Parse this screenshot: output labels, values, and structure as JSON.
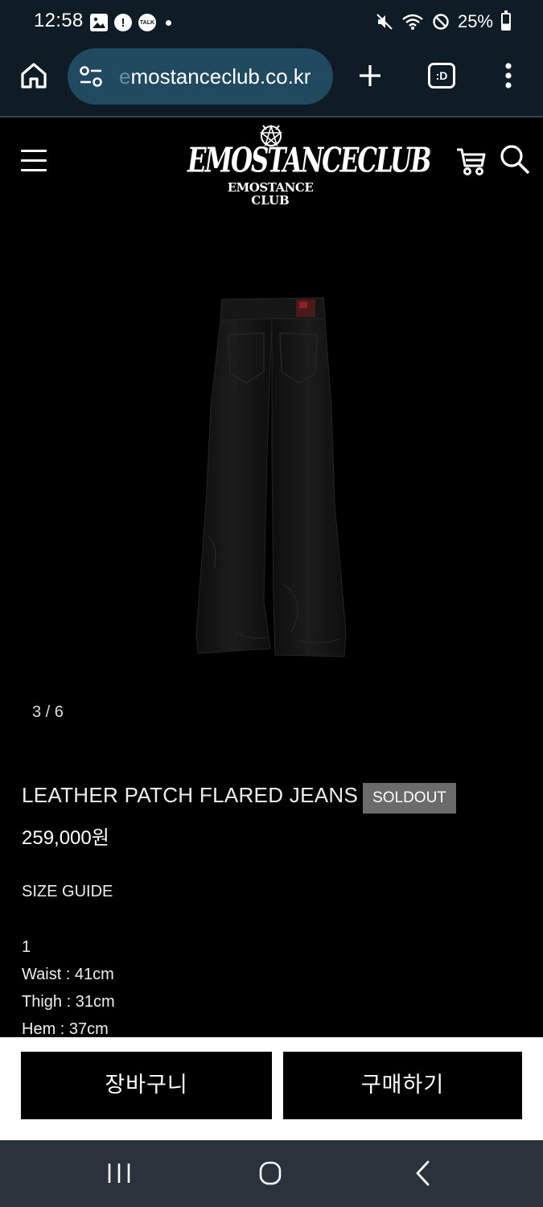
{
  "status_bar": {
    "time": "12:58",
    "battery": "25%",
    "left_icons": [
      "gallery-icon",
      "alert-icon",
      "kakaotalk-icon",
      "dot-icon"
    ],
    "talk_label": "TALK",
    "alert_label": "!",
    "right_icons": [
      "mute-icon",
      "wifi-icon",
      "do-not-disturb-icon",
      "battery-icon"
    ]
  },
  "browser": {
    "url_prefix": "e",
    "url": "mostanceclub.co.kr",
    "tabs_label": ":D",
    "icons": [
      "home-icon",
      "site-settings-icon",
      "plus-icon",
      "tabs-icon",
      "more-vert-icon"
    ]
  },
  "site_header": {
    "logo_main": "EMOSTANCECLUB",
    "logo_sub_1": "EMOSTANCE",
    "logo_sub_2": "CLUB",
    "icons": [
      "hamburger-menu-icon",
      "cart-icon",
      "search-icon"
    ]
  },
  "gallery": {
    "counter": "3 / 6"
  },
  "product": {
    "name": "LEATHER PATCH FLARED JEANS",
    "badge": "SOLDOUT",
    "price": "259,000원",
    "size_guide_title": "SIZE GUIDE",
    "size_lines": [
      "1",
      "Waist : 41cm",
      "Thigh : 31cm",
      "Hem : 37cm"
    ]
  },
  "actions": {
    "cart_label": "장바구니",
    "buy_label": "구매하기"
  },
  "nav_bar": {
    "icons": [
      "recent-apps-icon",
      "home-circle-icon",
      "back-icon"
    ]
  },
  "colors": {
    "chrome_bg": "#0f1c26",
    "url_pill": "#1f4a5f",
    "page_bg": "#000000",
    "badge_bg": "#6b6b6b",
    "action_bar_bg": "#ffffff",
    "nav_bar_bg": "#2a333b"
  }
}
